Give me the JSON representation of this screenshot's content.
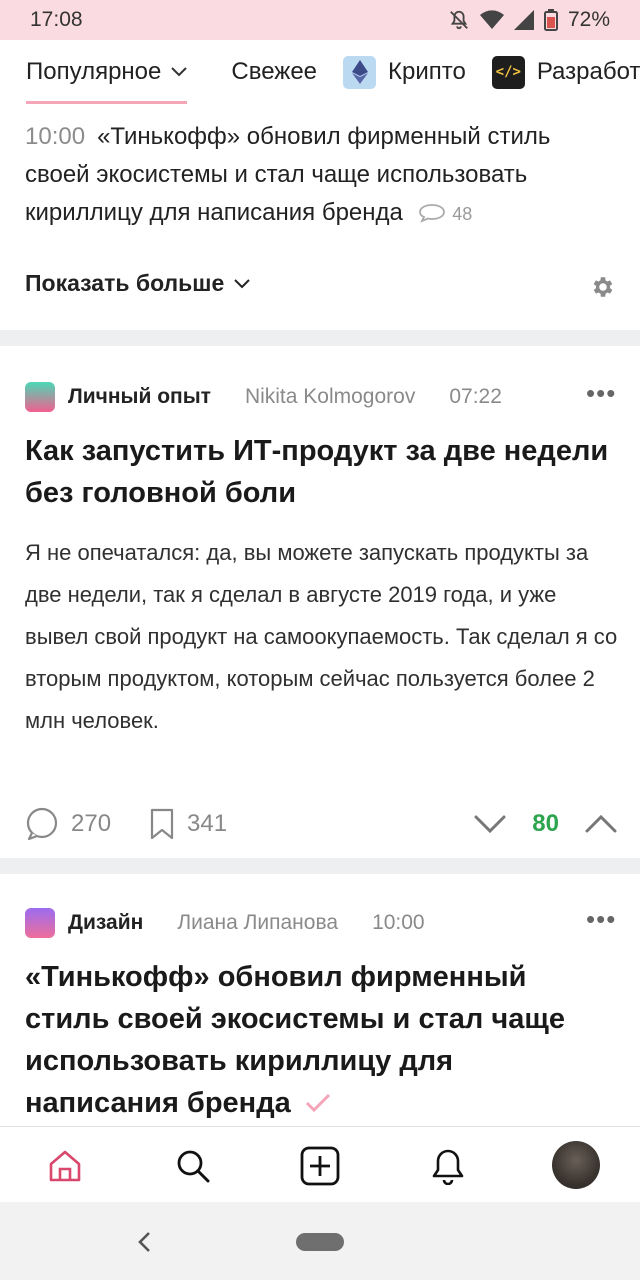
{
  "status_bar": {
    "time": "17:08",
    "battery": "72%"
  },
  "tabs": [
    {
      "label": "Популярное"
    },
    {
      "label": "Свежее"
    },
    {
      "label": "Крипто"
    },
    {
      "label": "Разработка"
    }
  ],
  "news": {
    "time": "10:00",
    "text": "«Тинькофф» обновил фирменный стиль своей экосистемы и стал чаще использовать кириллицу для написания бренда",
    "comments": "48"
  },
  "show_more_label": "Показать больше",
  "posts": [
    {
      "hub": "Личный опыт",
      "author": "Nikita Kolmogorov",
      "time": "07:22",
      "title": "Как запустить ИТ-продукт за две недели без головной боли",
      "excerpt": "Я не опечатался: да, вы можете запускать продукты за две недели, так я сделал в августе 2019 года, и уже вывел свой продукт на самоокупаемость. Так сделал я со вторым продуктом, которым сейчас пользуется более 2 млн человек.",
      "comments": "270",
      "bookmarks": "341",
      "score": "80"
    },
    {
      "hub": "Дизайн",
      "author": "Лиана Липанова",
      "time": "10:00",
      "title": "«Тинькофф» обновил фирменный стиль своей экосистемы и стал чаще использовать кириллицу для написания бренда"
    }
  ],
  "icons": {
    "nav": [
      "home-icon",
      "search-icon",
      "add-post-icon",
      "notifications-icon",
      "avatar"
    ],
    "status": [
      "mute-icon",
      "wifi-icon",
      "signal-icon",
      "battery-icon"
    ]
  },
  "colors": {
    "accent": "#f4a5b8",
    "positive_score": "#2da44e",
    "home_active": "#d9476d",
    "status_bar_bg": "#fadbe1"
  }
}
